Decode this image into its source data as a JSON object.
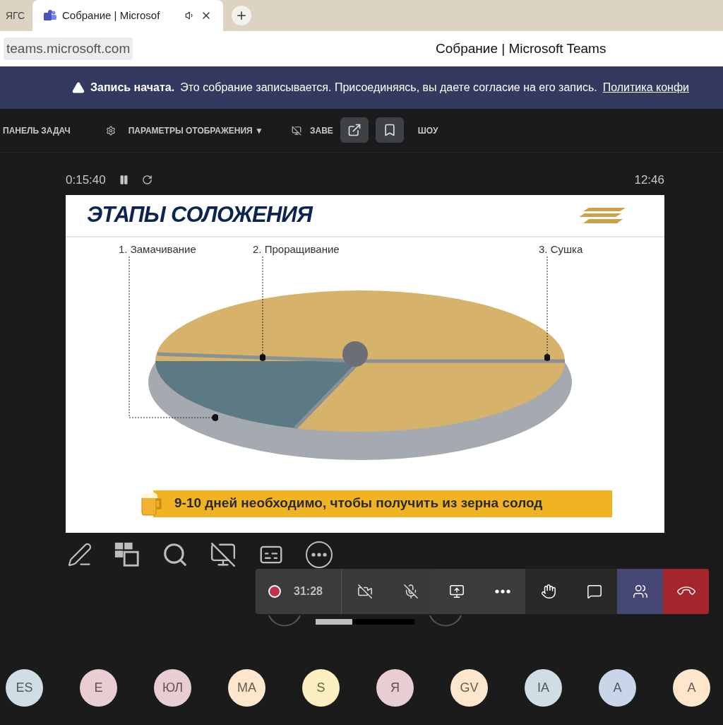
{
  "browser": {
    "tabs": [
      {
        "title": "ЯГС",
        "selected": false
      },
      {
        "title": "Собрание | Microsof",
        "selected": true,
        "audio": true
      }
    ],
    "address": "teams.microsoft.com",
    "page_title": "Собрание | Microsoft Teams"
  },
  "banner": {
    "bold": "Запись начата.",
    "text": "Это собрание записывается. Присоединяясь, вы даете согласие на его запись.",
    "link": "Политика конфи"
  },
  "presenter_bar": {
    "items": [
      {
        "kind": "taskbar",
        "label": "ПАНЕЛЬ ЗАДАЧ"
      },
      {
        "kind": "display",
        "label": "ПАРАМЕТРЫ ОТОБРАЖЕНИЯ ▼"
      },
      {
        "kind": "end",
        "label": "ЗАВЕ",
        "label_end": "ШОУ"
      }
    ]
  },
  "slide_meta": {
    "elapsed": "0:15:40",
    "clock": "12:46"
  },
  "slide": {
    "title": "ЭТАПЫ СОЛОЖЕНИЯ",
    "stages": [
      "1. Замачивание",
      "2. Проращивание",
      "3. Сушка"
    ],
    "banner": "9-10 дней необходимо, чтобы получить из зерна солод"
  },
  "slide_progress": {
    "level": 0.37
  },
  "call_bar": {
    "duration": "31:28",
    "recording": true,
    "items": [
      {
        "kind": "camera",
        "on": false,
        "selected": false
      },
      {
        "kind": "mic",
        "on": false,
        "selected": false
      },
      {
        "kind": "share",
        "on": true,
        "selected": false
      },
      {
        "kind": "more",
        "on": true,
        "selected": false
      },
      {
        "kind": "hand",
        "on": true,
        "selected": false
      },
      {
        "kind": "chat",
        "on": true,
        "selected": false
      },
      {
        "kind": "people",
        "on": true,
        "selected": true
      },
      {
        "kind": "hangup",
        "on": true,
        "selected": false
      }
    ]
  },
  "participants": [
    {
      "initials": "ES",
      "color": "#cfdde5"
    },
    {
      "initials": "E",
      "color": "#e8cdd2"
    },
    {
      "initials": "ЮЛ",
      "color": "#e8cdd2"
    },
    {
      "initials": "MA",
      "color": "#fde6cc"
    },
    {
      "initials": "S",
      "color": "#fdefbf"
    },
    {
      "initials": "Я",
      "color": "#e8cdd2"
    },
    {
      "initials": "GV",
      "color": "#fde6cc"
    },
    {
      "initials": "IA",
      "color": "#cfdde5"
    },
    {
      "initials": "A",
      "color": "#c9d6ea"
    },
    {
      "initials": "A",
      "color": "#fde6cc"
    }
  ]
}
